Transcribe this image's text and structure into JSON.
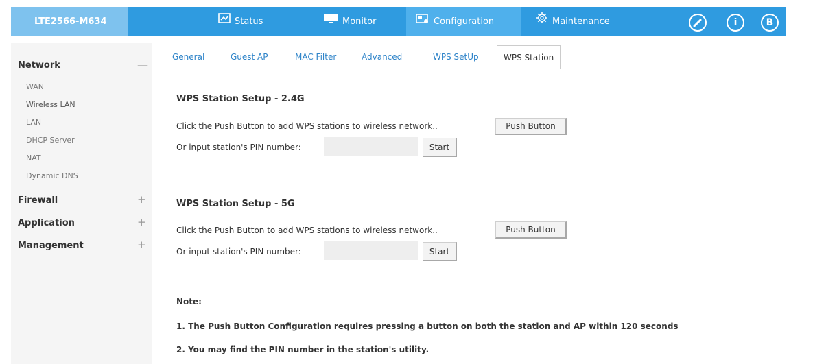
{
  "header": {
    "brand": "LTE2566-M634",
    "nav": [
      {
        "label": "Status",
        "icon": "status-icon"
      },
      {
        "label": "Monitor",
        "icon": "monitor-icon"
      },
      {
        "label": "Configuration",
        "icon": "configuration-icon"
      },
      {
        "label": "Maintenance",
        "icon": "maintenance-icon"
      }
    ],
    "right_icons": [
      "wizard-icon",
      "info-icon",
      "logout-icon"
    ],
    "info_glyph": "i",
    "logout_glyph": "B",
    "colors": {
      "bar": "#2f9be0",
      "brand_bg": "#7ec2ee",
      "active_nav": "#4fb0ec"
    }
  },
  "sidebar": {
    "groups": [
      {
        "label": "Network",
        "sign": "—",
        "items": [
          "WAN",
          "Wireless LAN",
          "LAN",
          "DHCP Server",
          "NAT",
          "Dynamic DNS"
        ],
        "selected": "Wireless LAN"
      },
      {
        "label": "Firewall",
        "sign": "+"
      },
      {
        "label": "Application",
        "sign": "+"
      },
      {
        "label": "Management",
        "sign": "+"
      }
    ]
  },
  "tabs": [
    "General",
    "Guest AP",
    "MAC Filter",
    "Advanced",
    "WPS SetUp",
    "WPS Station"
  ],
  "active_tab": "WPS Station",
  "sections": [
    {
      "title": "WPS Station Setup - 2.4G",
      "push_text": "Click the Push Button to add WPS stations to wireless network..",
      "push_button": "Push Button",
      "pin_label": "Or input station's PIN number:",
      "pin_value": "",
      "start_button": "Start"
    },
    {
      "title": "WPS Station Setup - 5G",
      "push_text": "Click the Push Button to add WPS stations to wireless network..",
      "push_button": "Push Button",
      "pin_label": "Or input station's PIN number:",
      "pin_value": "",
      "start_button": "Start"
    }
  ],
  "notes": {
    "title": "Note:",
    "lines": [
      "1. The Push Button Configuration requires pressing a button on both the station and AP within 120 seconds",
      "2. You may find the PIN number in the station's utility."
    ]
  }
}
